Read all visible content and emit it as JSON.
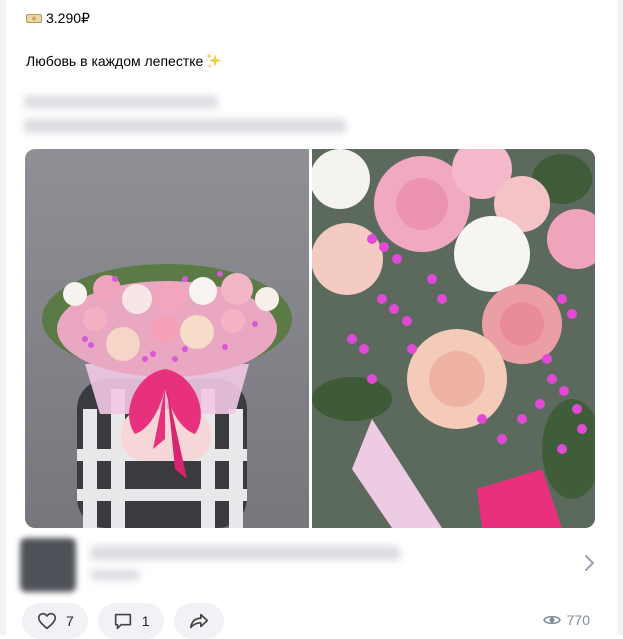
{
  "post": {
    "price": "3.290₽",
    "caption": "Любовь в каждом лепестке",
    "caption_emoji": "sparkles-icon"
  },
  "photos": [
    {
      "name": "bouquet-in-hands-photo"
    },
    {
      "name": "bouquet-closeup-photo"
    }
  ],
  "actions": {
    "likes": "7",
    "comments": "1",
    "views": "770"
  },
  "icons": {
    "price": "banknote-icon",
    "like": "heart-icon",
    "comment": "comment-icon",
    "share": "share-icon",
    "views": "eye-icon",
    "link_chevron": "chevron-right-icon"
  },
  "colors": {
    "accent_pink": "#e8317d",
    "pill_bg": "#f0f2f5",
    "muted_text": "#818c99"
  }
}
